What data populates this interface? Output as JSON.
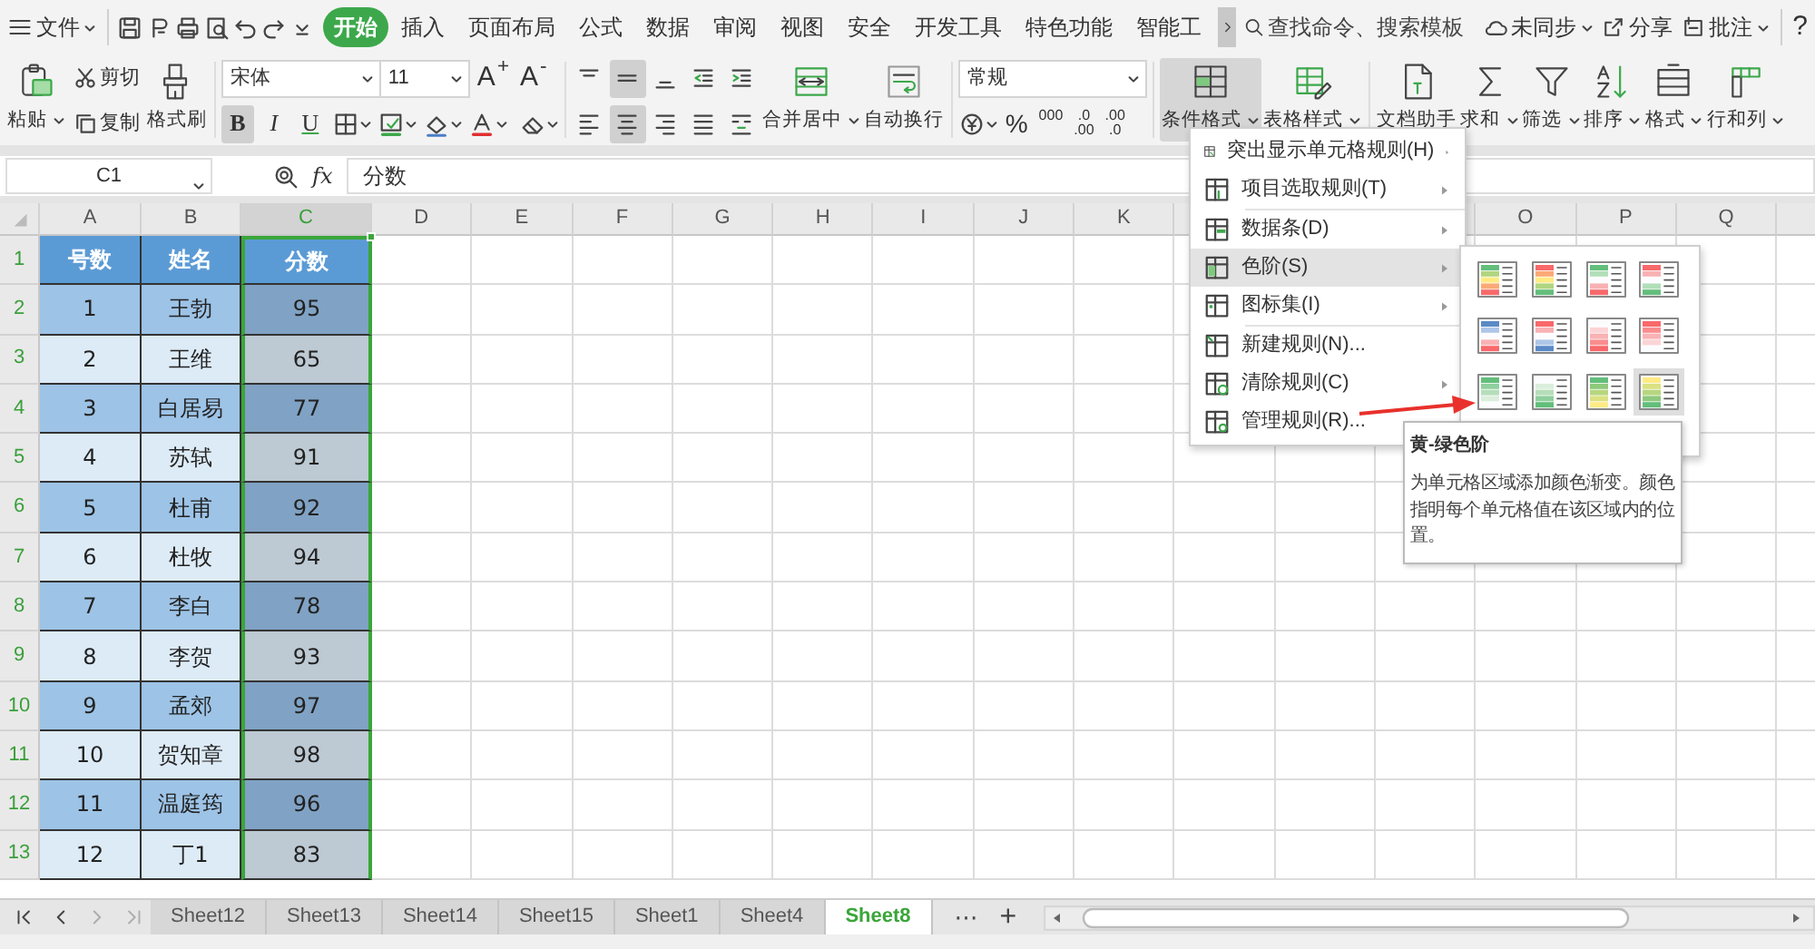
{
  "file_menu": {
    "label": "文件"
  },
  "tabs": [
    {
      "label": "开始",
      "selected": true
    },
    {
      "label": "插入",
      "selected": false
    },
    {
      "label": "页面布局",
      "selected": false
    },
    {
      "label": "公式",
      "selected": false
    },
    {
      "label": "数据",
      "selected": false
    },
    {
      "label": "审阅",
      "selected": false
    },
    {
      "label": "视图",
      "selected": false
    },
    {
      "label": "安全",
      "selected": false
    },
    {
      "label": "开发工具",
      "selected": false
    },
    {
      "label": "特色功能",
      "selected": false
    },
    {
      "label": "智能工",
      "selected": false
    }
  ],
  "search": {
    "placeholder": "查找命令、搜索模板"
  },
  "account": [
    {
      "label": "未同步",
      "dropdown": true
    },
    {
      "label": "分享",
      "dropdown": false
    },
    {
      "label": "批注",
      "dropdown": true
    }
  ],
  "help": "?",
  "ribbon": {
    "paste": {
      "label": "粘贴",
      "dropdown": true
    },
    "cut": "剪切",
    "copy": "复制",
    "painter": "格式刷",
    "font": "宋体",
    "size": "11",
    "grow": "A$^{+}$",
    "shrink": "A$^{-}$",
    "format_buttons": [
      {
        "text": "B",
        "active": true
      },
      {
        "text": "I",
        "active": false
      },
      {
        "text": "U",
        "active": false
      }
    ],
    "alignment": [
      {
        "active": false
      },
      {
        "active": true
      },
      {
        "active": false
      },
      {
        "active": false
      },
      {
        "active": false
      },
      {
        "active": false
      },
      {
        "active": true
      },
      {
        "active": false
      },
      {
        "active": false
      },
      {
        "active": false
      }
    ],
    "merge": {
      "label": "合并居中",
      "dropdown": true
    },
    "wrap": {
      "label": "自动换行",
      "dropdown": false
    },
    "number_format": "常规",
    "percent": "%",
    "thousands": "000",
    "decimals": [
      {
        "lines": [
          ".0",
          ".00"
        ]
      },
      {
        "lines": [
          ".00",
          ".0"
        ]
      }
    ],
    "tools": [
      {
        "label": "条件格式",
        "dropdown": true,
        "active": true
      },
      {
        "label": "表格样式",
        "dropdown": true,
        "active": false
      },
      {
        "label": "文档助手",
        "dropdown": false,
        "active": false
      },
      {
        "label": "求和",
        "dropdown": true,
        "active": false
      },
      {
        "label": "筛选",
        "dropdown": true,
        "active": false
      },
      {
        "label": "排序",
        "dropdown": true,
        "active": false
      },
      {
        "label": "格式",
        "dropdown": true,
        "active": false
      },
      {
        "label": "行和列",
        "dropdown": true,
        "active": false
      }
    ]
  },
  "formula_bar": {
    "cell": "C1",
    "fx": "fx",
    "value": "分数"
  },
  "sheet": {
    "columns": [
      {
        "label": "A",
        "selected": false
      },
      {
        "label": "B",
        "selected": false
      },
      {
        "label": "C",
        "selected": true
      },
      {
        "label": "D",
        "selected": false
      },
      {
        "label": "E",
        "selected": false
      },
      {
        "label": "F",
        "selected": false
      },
      {
        "label": "G",
        "selected": false
      },
      {
        "label": "H",
        "selected": false
      },
      {
        "label": "I",
        "selected": false
      },
      {
        "label": "J",
        "selected": false
      },
      {
        "label": "K",
        "selected": false
      },
      {
        "label": "O",
        "selected": false
      },
      {
        "label": "P",
        "selected": false
      },
      {
        "label": "Q",
        "selected": false
      }
    ],
    "rows": [
      {
        "number": "1",
        "selected": true,
        "kind": "header",
        "cells": [
          {
            "text": "号数",
            "selected": false
          },
          {
            "text": "姓名",
            "selected": false
          },
          {
            "text": "分数",
            "selected": false,
            "active": true
          }
        ]
      },
      {
        "number": "2",
        "selected": true,
        "kind": "data",
        "cells": [
          {
            "text": "1",
            "selected": false
          },
          {
            "text": "王勃",
            "selected": false
          },
          {
            "text": "95",
            "selected": true
          }
        ]
      },
      {
        "number": "3",
        "selected": true,
        "kind": "data",
        "cells": [
          {
            "text": "2",
            "selected": false
          },
          {
            "text": "王维",
            "selected": false
          },
          {
            "text": "65",
            "selected": true
          }
        ]
      },
      {
        "number": "4",
        "selected": true,
        "kind": "data",
        "cells": [
          {
            "text": "3",
            "selected": false
          },
          {
            "text": "白居易",
            "selected": false
          },
          {
            "text": "77",
            "selected": true
          }
        ]
      },
      {
        "number": "5",
        "selected": true,
        "kind": "data",
        "cells": [
          {
            "text": "4",
            "selected": false
          },
          {
            "text": "苏轼",
            "selected": false
          },
          {
            "text": "91",
            "selected": true
          }
        ]
      },
      {
        "number": "6",
        "selected": true,
        "kind": "data",
        "cells": [
          {
            "text": "5",
            "selected": false
          },
          {
            "text": "杜甫",
            "selected": false
          },
          {
            "text": "92",
            "selected": true
          }
        ]
      },
      {
        "number": "7",
        "selected": true,
        "kind": "data",
        "cells": [
          {
            "text": "6",
            "selected": false
          },
          {
            "text": "杜牧",
            "selected": false
          },
          {
            "text": "94",
            "selected": true
          }
        ]
      },
      {
        "number": "8",
        "selected": true,
        "kind": "data",
        "cells": [
          {
            "text": "7",
            "selected": false
          },
          {
            "text": "李白",
            "selected": false
          },
          {
            "text": "78",
            "selected": true
          }
        ]
      },
      {
        "number": "9",
        "selected": true,
        "kind": "data",
        "cells": [
          {
            "text": "8",
            "selected": false
          },
          {
            "text": "李贺",
            "selected": false
          },
          {
            "text": "93",
            "selected": true
          }
        ]
      },
      {
        "number": "10",
        "selected": true,
        "kind": "data",
        "cells": [
          {
            "text": "9",
            "selected": false
          },
          {
            "text": "孟郊",
            "selected": false
          },
          {
            "text": "97",
            "selected": true
          }
        ]
      },
      {
        "number": "11",
        "selected": true,
        "kind": "data",
        "cells": [
          {
            "text": "10",
            "selected": false
          },
          {
            "text": "贺知章",
            "selected": false
          },
          {
            "text": "98",
            "selected": true
          }
        ]
      },
      {
        "number": "12",
        "selected": true,
        "kind": "data",
        "cells": [
          {
            "text": "11",
            "selected": false
          },
          {
            "text": "温庭筠",
            "selected": false
          },
          {
            "text": "96",
            "selected": true
          }
        ]
      },
      {
        "number": "13",
        "selected": true,
        "kind": "data",
        "cells": [
          {
            "text": "12",
            "selected": false
          },
          {
            "text": "丁1",
            "selected": false
          },
          {
            "text": "83",
            "selected": true
          }
        ]
      }
    ]
  },
  "sheet_nav": [
    {
      "disabled": false
    },
    {
      "disabled": false
    },
    {
      "disabled": true
    },
    {
      "disabled": true
    }
  ],
  "sheet_tabs": [
    {
      "label": "Sheet12",
      "selected": false
    },
    {
      "label": "Sheet13",
      "selected": false
    },
    {
      "label": "Sheet14",
      "selected": false
    },
    {
      "label": "Sheet15",
      "selected": false
    },
    {
      "label": "Sheet1",
      "selected": false
    },
    {
      "label": "Sheet4",
      "selected": false
    },
    {
      "label": "Sheet8",
      "selected": true
    }
  ],
  "more_tabs": "⋯",
  "add_tab": "+",
  "menu": {
    "items": [
      {
        "label": "突出显示单元格规则(H)",
        "submenu": true,
        "selected": false,
        "separator_after": false
      },
      {
        "label": "项目选取规则(T)",
        "submenu": true,
        "selected": false,
        "separator_after": true
      },
      {
        "label": "数据条(D)",
        "submenu": true,
        "selected": false,
        "separator_after": false
      },
      {
        "label": "色阶(S)",
        "submenu": true,
        "selected": true,
        "separator_after": false
      },
      {
        "label": "图标集(I)",
        "submenu": true,
        "selected": false,
        "separator_after": true
      },
      {
        "label": "新建规则(N)...",
        "submenu": false,
        "selected": false,
        "separator_after": false
      },
      {
        "label": "清除规则(C)",
        "submenu": true,
        "selected": false,
        "separator_after": false
      },
      {
        "label": "管理规则(R)...",
        "submenu": false,
        "selected": false,
        "separator_after": false
      }
    ]
  },
  "color_scales": [
    {
      "selected": false
    },
    {
      "selected": false
    },
    {
      "selected": false
    },
    {
      "selected": false
    },
    {
      "selected": false
    },
    {
      "selected": false
    },
    {
      "selected": false
    },
    {
      "selected": false
    },
    {
      "selected": false
    },
    {
      "selected": false
    },
    {
      "selected": false
    },
    {
      "selected": true
    }
  ],
  "tooltip": {
    "title": "黄-绿色阶",
    "description": "为单元格区域添加颜色渐变。颜色指明每个单元格值在该区域内的位置。"
  }
}
